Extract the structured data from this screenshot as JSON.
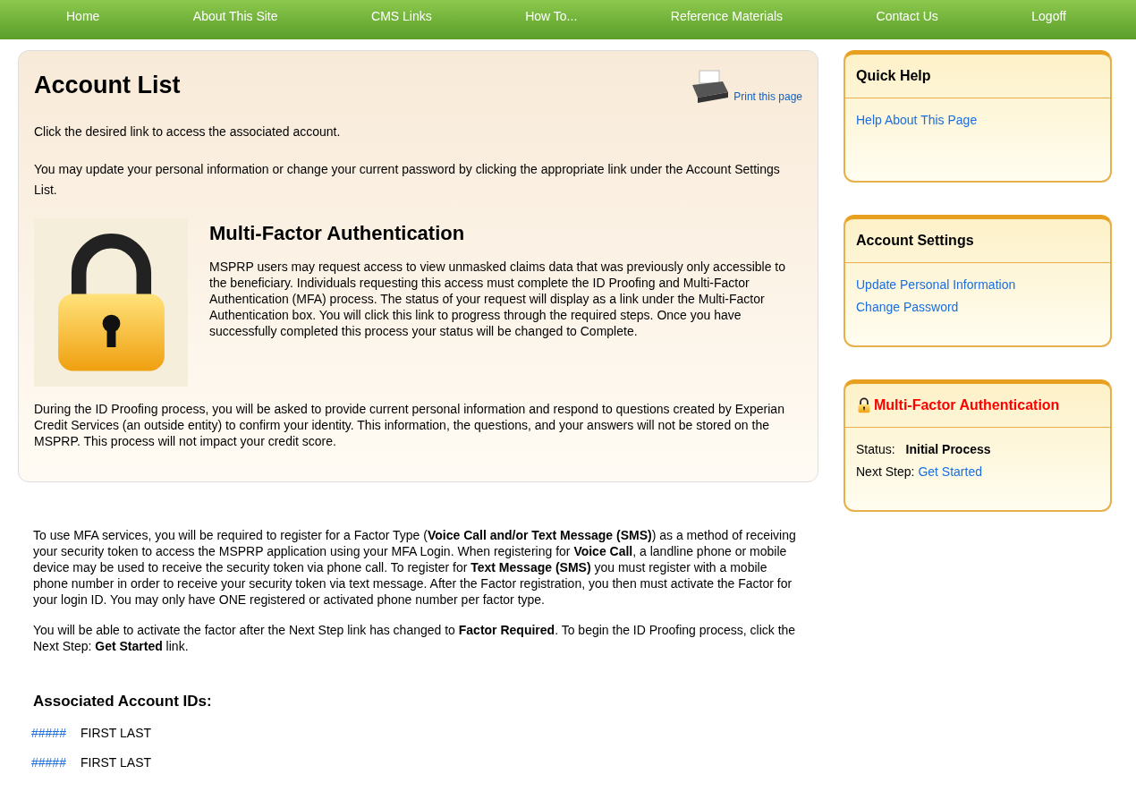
{
  "nav": [
    "Home",
    "About This Site",
    "CMS Links",
    "How To...",
    "Reference Materials",
    "Contact Us",
    "Logoff"
  ],
  "main": {
    "title": "Account List",
    "print_link": "Print this page",
    "intro": [
      "Click the desired link to access the associated account.",
      "You may update your personal information or change your current password by clicking the appropriate link under the Account Settings List."
    ],
    "mfa_heading": "Multi-Factor Authentication",
    "mfa_text": "MSPRP users may request access to view unmasked claims data that was previously only accessible to the beneficiary. Individuals requesting this access must complete the ID Proofing and Multi-Factor Authentication (MFA) process. The status of your request will display as a link under the Multi-Factor Authentication box. You will click this link to progress through the required steps. Once you have successfully completed this process your status will be changed to Complete.",
    "id_proofing_text": "During the ID Proofing process, you will be asked to provide current personal information and respond to questions created by Experian Credit Services (an outside entity) to confirm your identity. This information, the questions, and your answers will not be stored on the MSPRP. This process will not impact your credit score.",
    "factor_text": "To use MFA services, you will be required to register for a Factor Type (**Voice Call and/or Text Message (SMS)**) as a method of receiving your security token to access the MSPRP application using your MFA Login. When registering for **Voice Call**, a landline phone or mobile device may be used to receive the security token via phone call. To register for **Text Message (SMS)** you must register with a mobile phone number in order to receive your security token via text message. After the Factor registration, you then must activate the Factor for your login ID. You may only have ONE registered or activated phone number per factor type.",
    "activate_text": "You will be able to activate the factor after the Next Step link has changed to **Factor Required**. To begin the ID Proofing process, click the Next Step: **Get Started** link.",
    "accounts_heading": "Associated Account IDs:",
    "accounts": [
      {
        "id": "#####",
        "name": "FIRST LAST"
      },
      {
        "id": "#####",
        "name": "FIRST LAST"
      }
    ]
  },
  "sidebar": [
    {
      "kind": "links",
      "title": "Quick Help",
      "links": [
        "Help About This Page"
      ]
    },
    {
      "kind": "links",
      "title": "Account Settings",
      "links": [
        "Update Personal Information",
        "Change Password"
      ]
    },
    {
      "kind": "status",
      "title": "Multi-Factor Authentication",
      "status_label": "Status:",
      "status_value": "Initial Process",
      "next_label": "Next Step:",
      "next_link": "Get Started"
    }
  ]
}
